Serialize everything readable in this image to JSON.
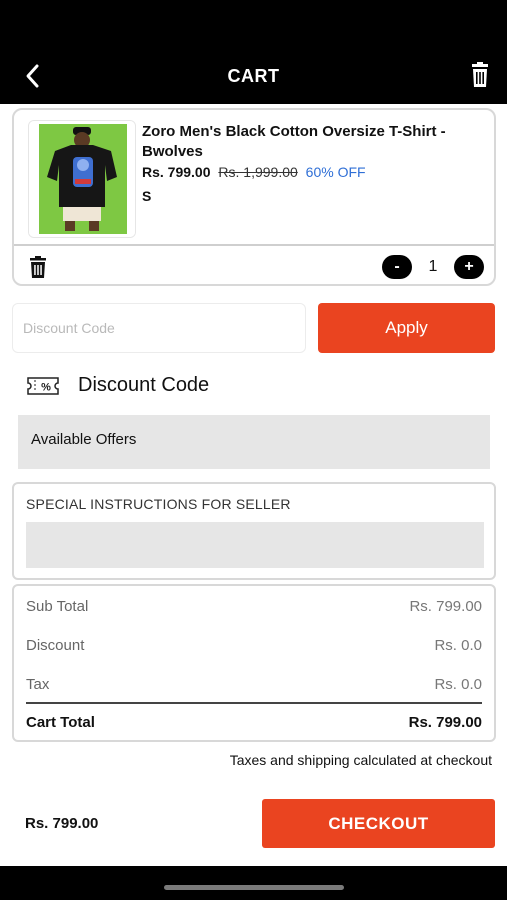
{
  "header": {
    "title": "CART",
    "back_icon": "chevron-left-icon",
    "delete_icon": "trash-icon"
  },
  "cart_item": {
    "name": "Zoro Men's Black Cotton Oversize T-Shirt - Bwolves",
    "price": "Rs. 799.00",
    "mrp": "Rs. 1,999.00",
    "discount": "60% OFF",
    "size": "S",
    "quantity": "1",
    "minus_label": "-",
    "plus_label": "+",
    "delete_icon": "trash-icon"
  },
  "discount": {
    "placeholder": "Discount Code",
    "value": "",
    "apply_label": "Apply",
    "section_title": "Discount Code",
    "icon": "coupon-percent-icon"
  },
  "offers": {
    "label": "Available Offers"
  },
  "instructions": {
    "label": "SPECIAL INSTRUCTIONS FOR SELLER",
    "value": ""
  },
  "summary": {
    "subtotal_label": "Sub Total",
    "subtotal_value": "Rs. 799.00",
    "discount_label": "Discount",
    "discount_value": "Rs. 0.0",
    "tax_label": "Tax",
    "tax_value": "Rs. 0.0",
    "total_label": "Cart Total",
    "total_value": "Rs. 799.00"
  },
  "tax_note": "Taxes and shipping calculated at checkout",
  "footer": {
    "total": "Rs. 799.00",
    "checkout_label": "CHECKOUT"
  },
  "colors": {
    "accent": "#ea4420",
    "offer_text": "#2f6fd6",
    "header_bg": "#000000"
  }
}
